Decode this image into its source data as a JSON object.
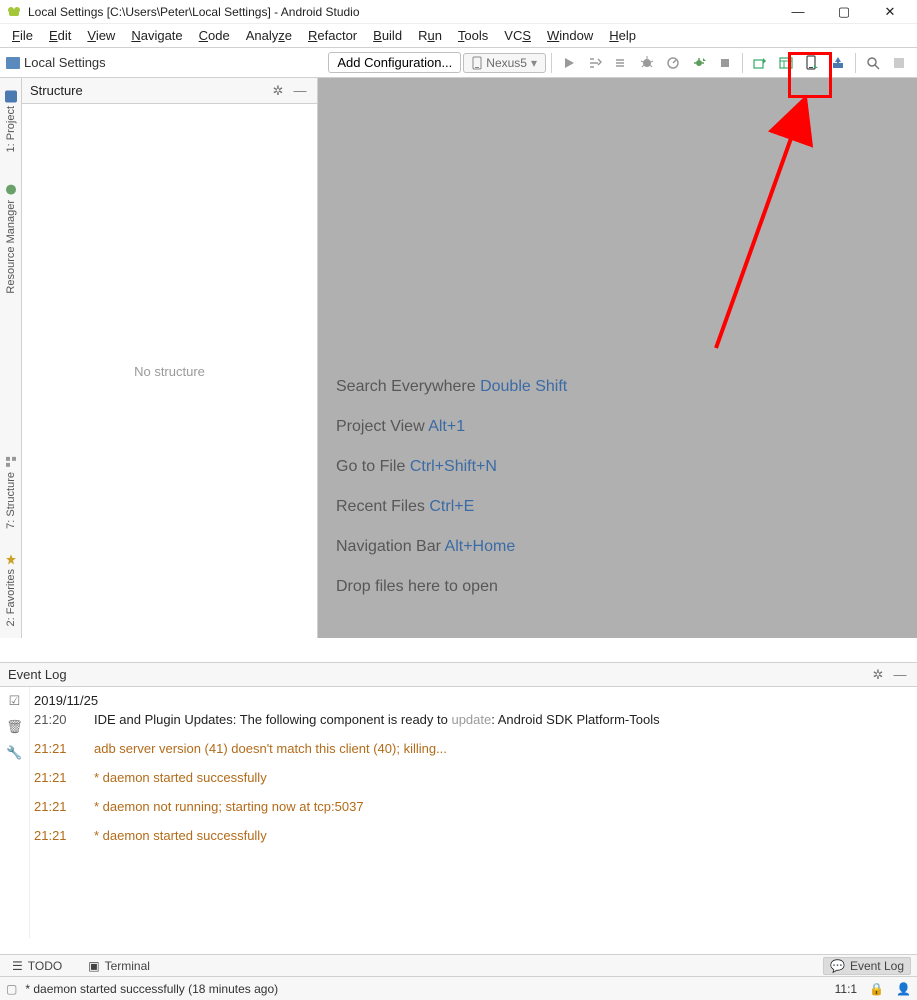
{
  "window": {
    "title": "Local Settings [C:\\Users\\Peter\\Local Settings] - Android Studio"
  },
  "menu": [
    "File",
    "Edit",
    "View",
    "Navigate",
    "Code",
    "Analyze",
    "Refactor",
    "Build",
    "Run",
    "Tools",
    "VCS",
    "Window",
    "Help"
  ],
  "breadcrumb": {
    "label": "Local Settings"
  },
  "toolbar": {
    "config": "Add Configuration...",
    "device": "Nexus5"
  },
  "structure": {
    "title": "Structure",
    "empty": "No structure"
  },
  "sideTabs": {
    "project": "1: Project",
    "resmgr": "Resource Manager",
    "structure": "7: Structure",
    "favorites": "2: Favorites"
  },
  "hints": [
    {
      "label": "Search Everywhere ",
      "shortcut": "Double Shift"
    },
    {
      "label": "Project View ",
      "shortcut": "Alt+1"
    },
    {
      "label": "Go to File ",
      "shortcut": "Ctrl+Shift+N"
    },
    {
      "label": "Recent Files ",
      "shortcut": "Ctrl+E"
    },
    {
      "label": "Navigation Bar ",
      "shortcut": "Alt+Home"
    },
    {
      "label": "Drop files here to open",
      "shortcut": ""
    }
  ],
  "eventLog": {
    "title": "Event Log",
    "date": "2019/11/25",
    "entries": [
      {
        "time": "21:20",
        "msg_pre": "IDE and Plugin Updates: The following component is ready to ",
        "msg_link": "update",
        "msg_post": ": Android SDK Platform-Tools",
        "warn": false
      },
      {
        "time": "21:21",
        "msg": "adb server version (41) doesn't match this client (40); killing...",
        "warn": true
      },
      {
        "time": "21:21",
        "msg": "* daemon started successfully",
        "warn": true
      },
      {
        "time": "21:21",
        "msg": "* daemon not running; starting now at tcp:5037",
        "warn": true
      },
      {
        "time": "21:21",
        "msg": "* daemon started successfully",
        "warn": true
      }
    ]
  },
  "bottomTabs": {
    "todo": "TODO",
    "terminal": "Terminal",
    "eventlog": "Event Log"
  },
  "status": {
    "msg": "* daemon started successfully (18 minutes ago)",
    "pos": "11:1"
  }
}
